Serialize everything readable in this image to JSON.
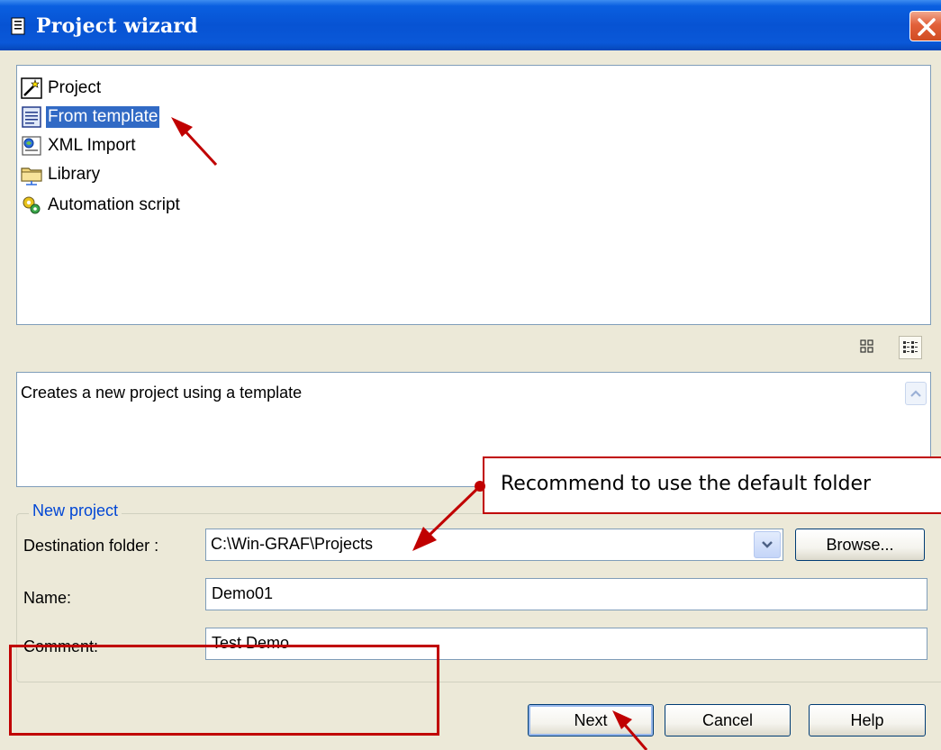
{
  "window": {
    "title": "Project wizard"
  },
  "project_types": [
    {
      "label": "Project",
      "icon": "project-wand-icon"
    },
    {
      "label": "From template",
      "icon": "template-document-icon",
      "selected": true
    },
    {
      "label": "XML Import",
      "icon": "xml-import-icon"
    },
    {
      "label": "Library",
      "icon": "library-folder-icon"
    },
    {
      "label": "Automation script",
      "icon": "automation-script-icon"
    }
  ],
  "description": "Creates a new project using a template",
  "new_project": {
    "group_label": "New project",
    "destination_label": "Destination folder :",
    "destination_value": "C:\\Win-GRAF\\Projects",
    "browse_label": "Browse...",
    "name_label": "Name:",
    "name_value": "Demo01",
    "comment_label": "Comment:",
    "comment_value": "Test Demo"
  },
  "buttons": {
    "next": "Next",
    "cancel": "Cancel",
    "help": "Help"
  },
  "annotation": {
    "callout_text": "Recommend to use the default folder"
  },
  "colors": {
    "title_bar": "#0753d3",
    "selection": "#316ac5",
    "annotation": "#c00000",
    "group_label": "#0046d5"
  }
}
